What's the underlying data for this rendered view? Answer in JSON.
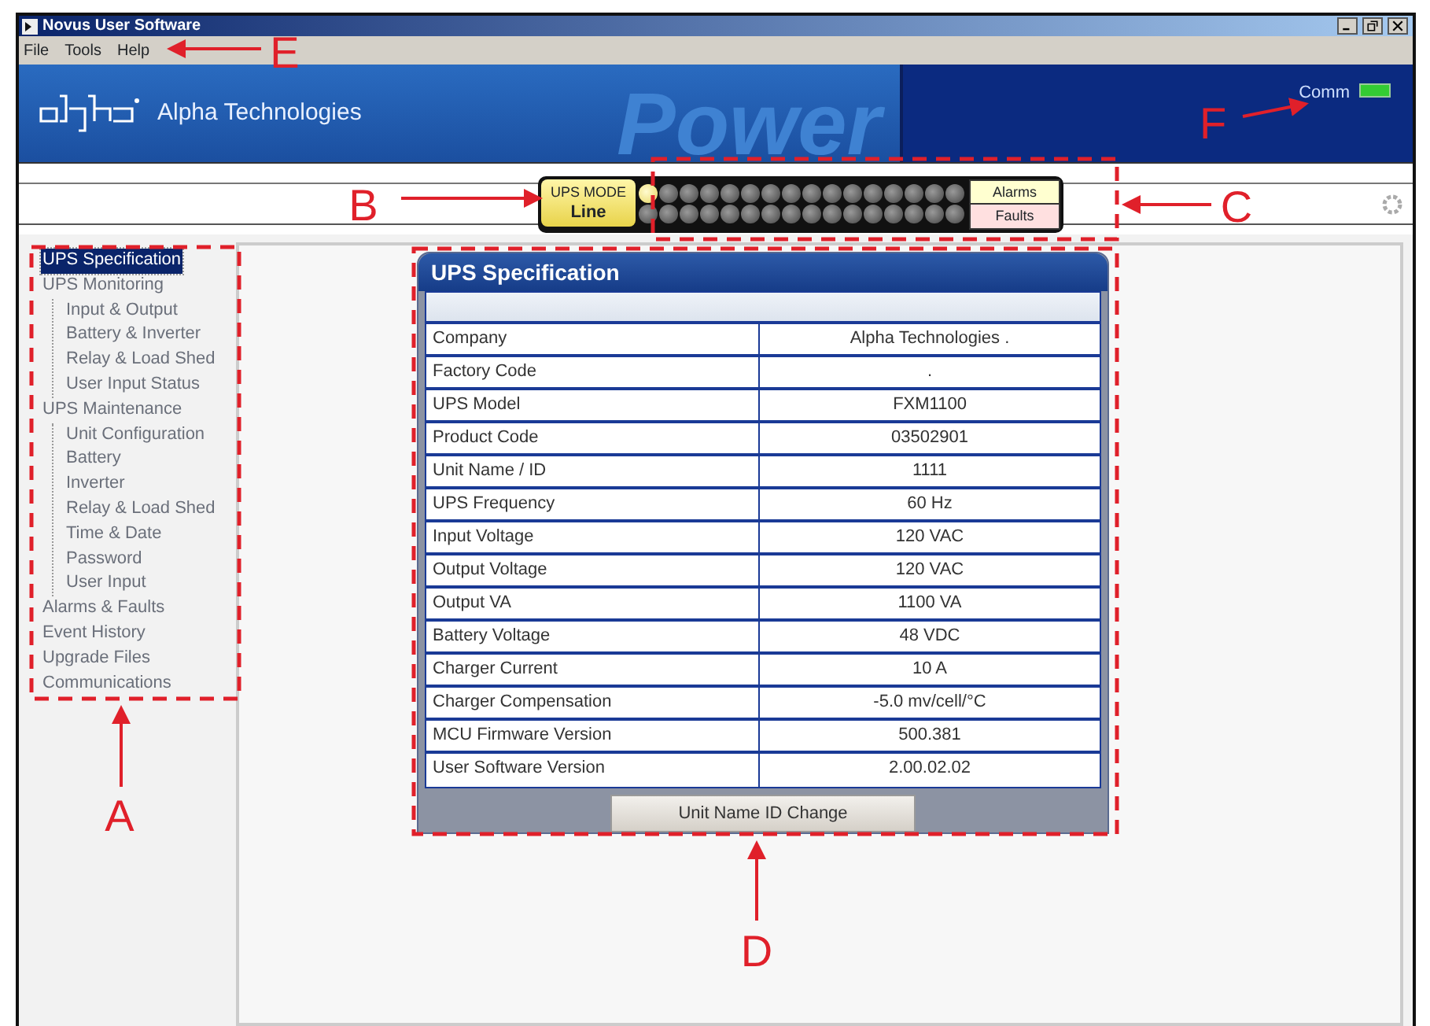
{
  "window": {
    "title": "Novus User Software"
  },
  "menu": [
    "File",
    "Tools",
    "Help"
  ],
  "banner": {
    "company": "Alpha Technologies",
    "art_text": "Power",
    "comm_label": "Comm",
    "comm_on": true
  },
  "mode": {
    "label": "UPS MODE",
    "value": "Line"
  },
  "alarm_leds": [
    {
      "on": true
    },
    {
      "on": false
    },
    {
      "on": false
    },
    {
      "on": false
    },
    {
      "on": false
    },
    {
      "on": false
    },
    {
      "on": false
    },
    {
      "on": false
    },
    {
      "on": false
    },
    {
      "on": false
    },
    {
      "on": false
    },
    {
      "on": false
    },
    {
      "on": false
    },
    {
      "on": false
    },
    {
      "on": false
    },
    {
      "on": false
    }
  ],
  "fault_leds": [
    {
      "on": false
    },
    {
      "on": false
    },
    {
      "on": false
    },
    {
      "on": false
    },
    {
      "on": false
    },
    {
      "on": false
    },
    {
      "on": false
    },
    {
      "on": false
    },
    {
      "on": false
    },
    {
      "on": false
    },
    {
      "on": false
    },
    {
      "on": false
    },
    {
      "on": false
    },
    {
      "on": false
    },
    {
      "on": false
    },
    {
      "on": false
    }
  ],
  "alarms_label": "Alarms",
  "faults_label": "Faults",
  "sidebar": {
    "items": [
      {
        "label": "UPS Specification",
        "selected": true
      },
      {
        "label": "UPS Monitoring",
        "selected": false,
        "children": [
          {
            "label": "Input & Output",
            "selected": false
          },
          {
            "label": "Battery & Inverter",
            "selected": false
          },
          {
            "label": "Relay & Load Shed",
            "selected": false
          },
          {
            "label": "User Input Status",
            "selected": false
          }
        ]
      },
      {
        "label": "UPS Maintenance",
        "selected": false,
        "children": [
          {
            "label": "Unit Configuration",
            "selected": false
          },
          {
            "label": "Battery",
            "selected": false
          },
          {
            "label": "Inverter",
            "selected": false
          },
          {
            "label": "Relay & Load Shed",
            "selected": false
          },
          {
            "label": "Time & Date",
            "selected": false
          },
          {
            "label": "Password",
            "selected": false
          },
          {
            "label": "User Input",
            "selected": false
          }
        ]
      },
      {
        "label": "Alarms & Faults",
        "selected": false
      },
      {
        "label": "Event History",
        "selected": false
      },
      {
        "label": "Upgrade Files",
        "selected": false
      },
      {
        "label": "Communications",
        "selected": false
      }
    ]
  },
  "spec_panel": {
    "title": "UPS Specification",
    "rows": [
      [
        "Company",
        "Alpha Technologies ."
      ],
      [
        "Factory Code",
        "."
      ],
      [
        "UPS Model",
        "FXM1100"
      ],
      [
        "Product Code",
        "03502901"
      ],
      [
        "Unit Name / ID",
        "1111"
      ],
      [
        "UPS Frequency",
        "60 Hz"
      ],
      [
        "Input Voltage",
        "120 VAC"
      ],
      [
        "Output Voltage",
        "120 VAC"
      ],
      [
        "Output VA",
        "1100 VA"
      ],
      [
        "Battery Voltage",
        "48 VDC"
      ],
      [
        "Charger Current",
        "10 A"
      ],
      [
        "Charger Compensation",
        "-5.0 mv/cell/°C"
      ],
      [
        "MCU Firmware Version",
        "500.381"
      ],
      [
        "User Software Version",
        "2.00.02.02"
      ]
    ],
    "button": "Unit Name ID Change"
  },
  "annotations": [
    {
      "label": "A"
    },
    {
      "label": "B"
    },
    {
      "label": "C"
    },
    {
      "label": "D"
    },
    {
      "label": "E"
    },
    {
      "label": "F"
    }
  ]
}
